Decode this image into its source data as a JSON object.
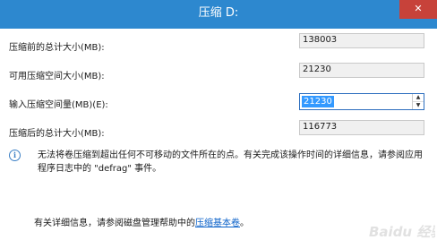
{
  "window": {
    "title": "压缩 D:"
  },
  "rows": [
    {
      "label": "压缩前的总计大小(MB):",
      "value": "138003"
    },
    {
      "label": "可用压缩空间大小(MB):",
      "value": "21230"
    },
    {
      "label": "输入压缩空间量(MB)(E):",
      "value": "21230"
    },
    {
      "label": "压缩后的总计大小(MB):",
      "value": "116773"
    }
  ],
  "info": {
    "text": "无法将卷压缩到超出任何不可移动的文件所在的点。有关完成该操作时间的详细信息，请参阅应用程序日志中的 \"defrag\" 事件。"
  },
  "help": {
    "prefix": "有关详细信息，请参阅磁盘管理帮助中的",
    "link": "压缩基本卷",
    "suffix": "。"
  },
  "watermark": "Baidu 经验",
  "icons": {
    "info": "info-icon",
    "spin_up": "arrow-up-icon",
    "spin_down": "arrow-down-icon"
  },
  "colors": {
    "titlebar": "#2d88cf",
    "close": "#c7423a",
    "selection": "#3399ff",
    "link": "#0a61c9"
  }
}
